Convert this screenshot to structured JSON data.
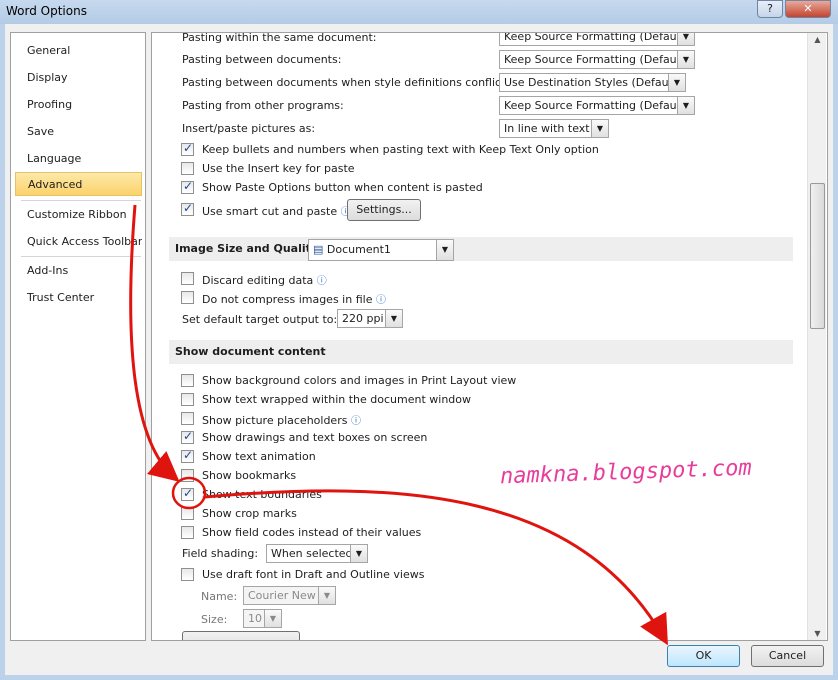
{
  "window": {
    "title": "Word Options",
    "help_label": "?",
    "close_label": "✕"
  },
  "nav": {
    "items": [
      {
        "label": "General"
      },
      {
        "label": "Display"
      },
      {
        "label": "Proofing"
      },
      {
        "label": "Save"
      },
      {
        "label": "Language"
      },
      {
        "label": "Advanced",
        "selected": true
      },
      {
        "label": "Customize Ribbon"
      },
      {
        "label": "Quick Access Toolbar"
      },
      {
        "label": "Add-Ins"
      },
      {
        "label": "Trust Center"
      }
    ]
  },
  "paste": {
    "rows": [
      {
        "label": "Pasting within the same document:",
        "value": "Keep Source Formatting (Default)"
      },
      {
        "label": "Pasting between documents:",
        "value": "Keep Source Formatting (Default)"
      },
      {
        "label": "Pasting between documents when style definitions conflict:",
        "value": "Use Destination Styles (Default)"
      },
      {
        "label": "Pasting from other programs:",
        "value": "Keep Source Formatting (Default)"
      },
      {
        "label": "Insert/paste pictures as:",
        "value": "In line with text"
      }
    ],
    "checks": [
      {
        "label": "Keep bullets and numbers when pasting text with Keep Text Only option",
        "checked": true
      },
      {
        "label": "Use the Insert key for paste",
        "checked": false
      },
      {
        "label": "Show Paste Options button when content is pasted",
        "checked": true
      },
      {
        "label": "Use smart cut and paste",
        "checked": true
      }
    ],
    "settings_label": "Settings..."
  },
  "image": {
    "header": "Image Size and Quality",
    "document": "Document1",
    "checks": [
      {
        "label": "Discard editing data",
        "checked": false
      },
      {
        "label": "Do not compress images in file",
        "checked": false
      }
    ],
    "target_label": "Set default target output to:",
    "target_value": "220 ppi"
  },
  "show": {
    "header": "Show document content",
    "checks": [
      {
        "label": "Show background colors and images in Print Layout view",
        "checked": false
      },
      {
        "label": "Show text wrapped within the document window",
        "checked": false
      },
      {
        "label": "Show picture placeholders",
        "checked": false
      },
      {
        "label": "Show drawings and text boxes on screen",
        "checked": true
      },
      {
        "label": "Show text animation",
        "checked": true
      },
      {
        "label": "Show bookmarks",
        "checked": false
      },
      {
        "label": "Show text boundaries",
        "checked": true
      },
      {
        "label": "Show crop marks",
        "checked": false
      },
      {
        "label": "Show field codes instead of their values",
        "checked": false
      }
    ],
    "shading_label": "Field shading:",
    "shading_value": "When selected",
    "draft_label": "Use draft font in Draft and Outline views",
    "draft_checked": false,
    "name_label": "Name:",
    "name_value": "Courier New",
    "size_label": "Size:",
    "size_value": "10"
  },
  "footer": {
    "ok": "OK",
    "cancel": "Cancel"
  },
  "watermark": "namkna.blogspot.com",
  "colors": {
    "annotation": "#e0140f",
    "selected_nav": "#fbd36b"
  }
}
